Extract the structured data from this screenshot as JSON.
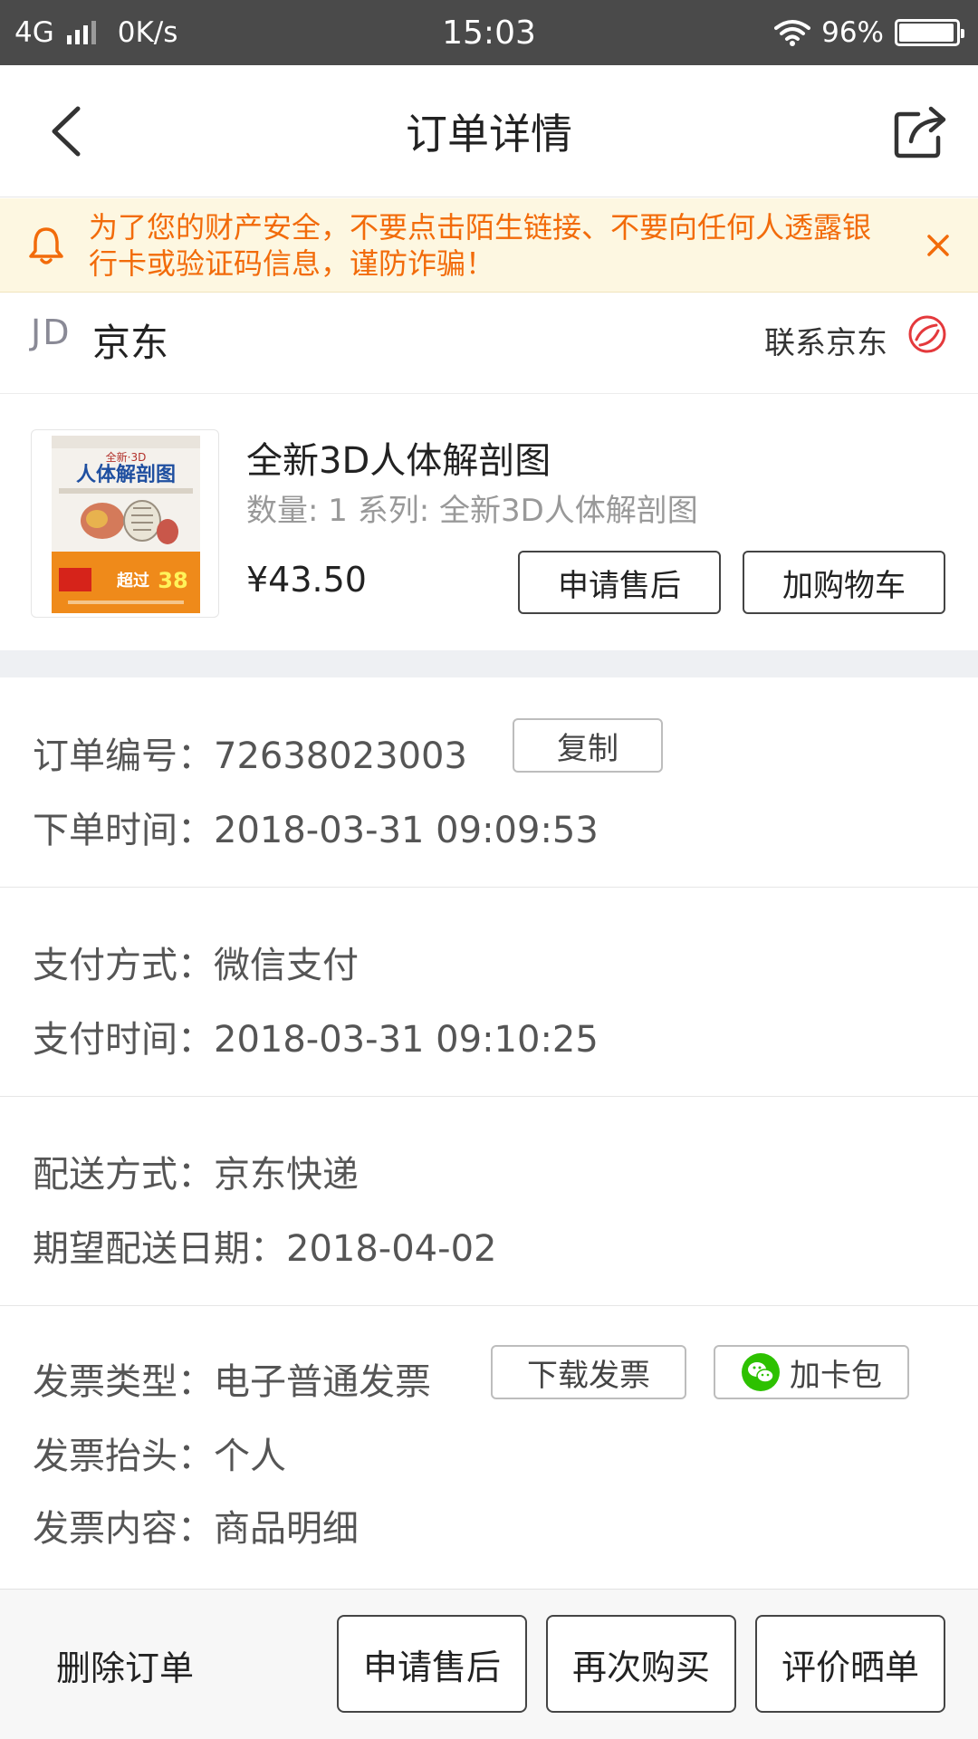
{
  "status_bar": {
    "network": "4G",
    "speed": "0K/s",
    "time": "15:03",
    "battery_percent": "96%",
    "battery_level": 0.96
  },
  "header": {
    "title": "订单详情",
    "back_icon": "chevron-left-icon",
    "share_icon": "share-icon"
  },
  "notice": {
    "text": "为了您的财产安全，不要点击陌生链接、不要向任何人透露银行卡或验证码信息，谨防诈骗！",
    "color": "#f26b0a"
  },
  "store": {
    "logo": "JD",
    "name": "京东",
    "contact_label": "联系京东"
  },
  "product": {
    "name": "全新3D人体解剖图",
    "meta": "数量: 1 系列: 全新3D人体解剖图",
    "price": "¥43.50",
    "after_sale_label": "申请售后",
    "add_cart_label": "加购物车",
    "cover": {
      "top_line": "全新·3D",
      "title": "人体解剖图",
      "badge": "超过",
      "badge_num": "38"
    }
  },
  "order": {
    "number_label": "订单编号：",
    "number": "72638023003",
    "copy_label": "复制",
    "time_label": "下单时间：",
    "time": "2018-03-31 09:09:53"
  },
  "payment": {
    "method_label": "支付方式：",
    "method": "微信支付",
    "time_label": "支付时间：",
    "time": "2018-03-31 09:10:25"
  },
  "delivery": {
    "method_label": "配送方式：",
    "method": "京东快递",
    "date_label": "期望配送日期：",
    "date": "2018-04-02"
  },
  "invoice": {
    "type_label": "发票类型：",
    "type": "电子普通发票",
    "download_label": "下载发票",
    "wallet_label": "加卡包",
    "title_label": "发票抬头：",
    "title": "个人",
    "content_label": "发票内容：",
    "content": "商品明细"
  },
  "bottom_bar": {
    "delete_label": "删除订单",
    "after_sale_label": "申请售后",
    "rebuy_label": "再次购买",
    "review_label": "评价晒单"
  },
  "colors": {
    "notice_bg": "#fdf7e1",
    "contact_icon": "#e4393c",
    "wechat": "#2dc100",
    "status_bar": "#4a4a4a"
  }
}
